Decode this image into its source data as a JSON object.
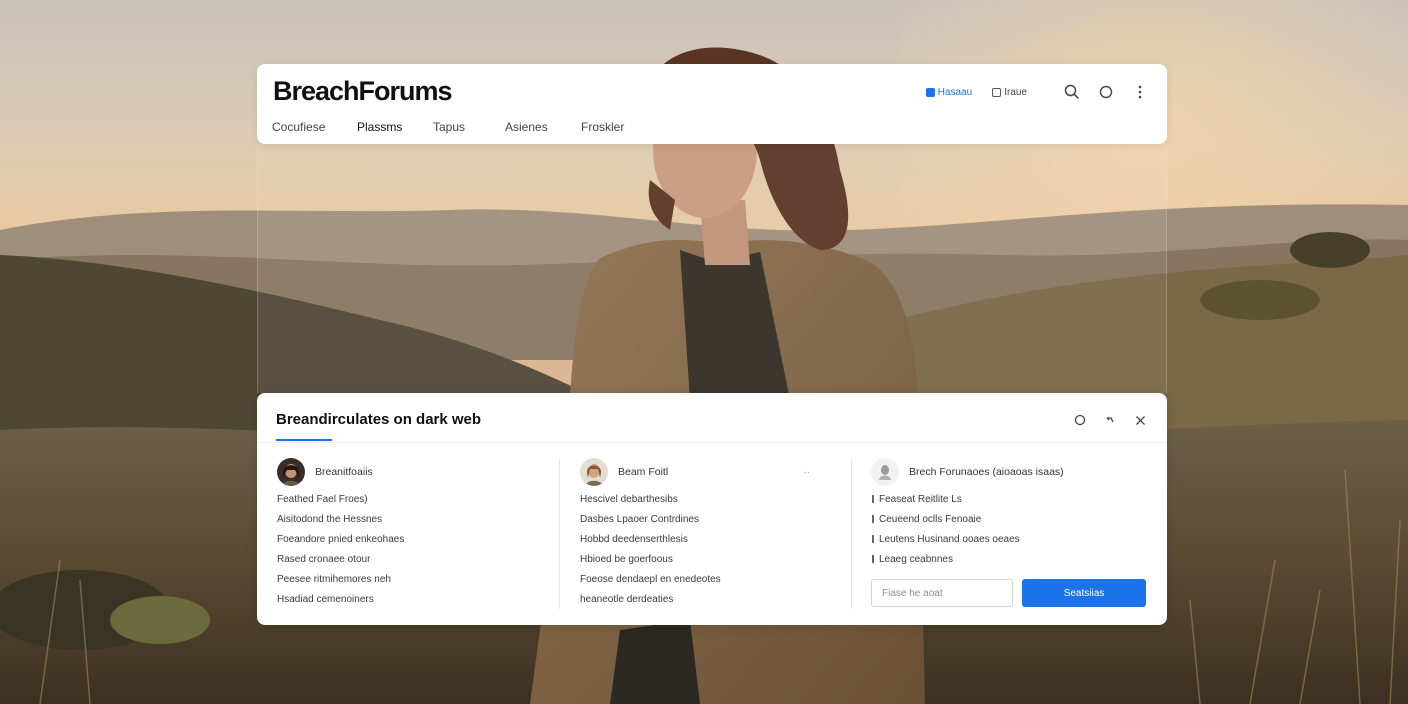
{
  "header": {
    "logo": "BreachForums",
    "nav": [
      "Cocufiese",
      "Plassms",
      "Tapus",
      "Asienes",
      "Froskler"
    ],
    "tool_links": [
      {
        "label": "Hasaau",
        "icon": "chat-icon",
        "accent": true
      },
      {
        "label": "Iraue",
        "icon": "bookmark-icon",
        "accent": false
      }
    ]
  },
  "panel": {
    "title": "Breandirculates on dark web",
    "columns": [
      {
        "name": "Breanitfoaiis",
        "items": [
          "Feathed Fael Froes)",
          "Aisitodond the Hessnes",
          "Foeandore pnied enkeohaes",
          "Rased cronaee otour",
          "Peesee ritmihemores neh",
          "Hsadiad cemenoiners"
        ]
      },
      {
        "name": "Beam Foitl",
        "more": "··",
        "items": [
          "Hescivel debarthesibs",
          "Dasbes Lpaoer Contrdines",
          "Hobbd deedenserthlesis",
          "Hbioed be goerfoous",
          "Foeose dendaepl en enedeotes",
          "heaneotle derdeaties"
        ]
      },
      {
        "name": "Brech Forunaoes (aioaoas isaas)",
        "items": [
          "Feaseat Reitlite Ls",
          "Ceueend oclls Fenoaie",
          "Leutens Husinand ooaes oeaes",
          "Leaeg ceabnnes"
        ]
      }
    ],
    "search": {
      "placeholder": "Fiase he aoat",
      "button": "Seatsiias"
    }
  },
  "colors": {
    "accent": "#1a73e8",
    "logo": "#111111",
    "panel_bg": "#ffffff"
  }
}
